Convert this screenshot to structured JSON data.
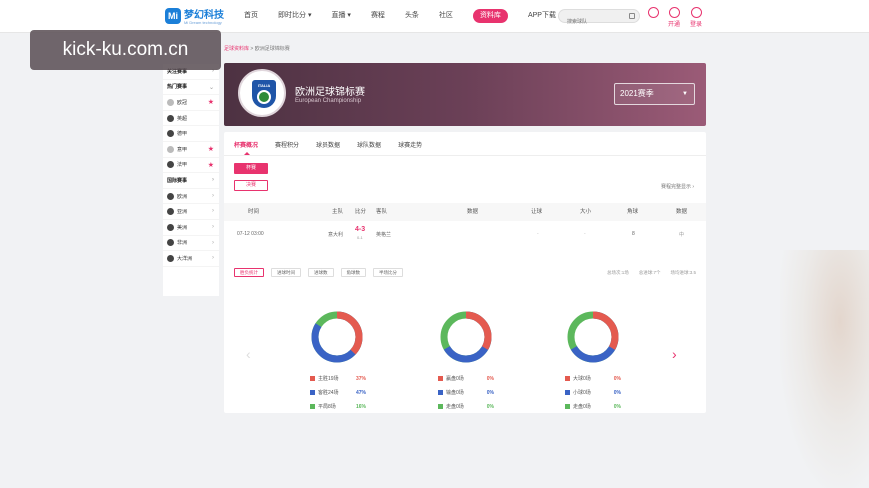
{
  "watermark": "kick-ku.com.cn",
  "header": {
    "logo_badge": "Mi",
    "logo_name": "梦幻科技",
    "logo_sub": "Mi Dream technology",
    "nav": [
      "首页",
      "即时比分 ▾",
      "直播 ▾",
      "赛程",
      "头条",
      "社区",
      "资料库",
      "APP下载"
    ],
    "search_placeholder": "搜索球队",
    "open_vip": "开通",
    "login": "登录"
  },
  "breadcrumb": {
    "link": "足球资料库",
    "sep": " > ",
    "current": "欧洲足球锦标赛"
  },
  "sidebar": {
    "items": [
      {
        "label": "关注赛事",
        "type": "head",
        "icon": "chevron-right"
      },
      {
        "label": "热门赛事",
        "type": "head",
        "icon": "chevron-down"
      },
      {
        "label": "欧冠",
        "type": "item",
        "icon": "star"
      },
      {
        "label": "英超",
        "type": "item"
      },
      {
        "label": "德甲",
        "type": "item"
      },
      {
        "label": "意甲",
        "type": "item",
        "icon": "star"
      },
      {
        "label": "法甲",
        "type": "item",
        "icon": "star"
      },
      {
        "label": "国际赛事",
        "type": "head",
        "icon": "chevron-right"
      },
      {
        "label": "欧洲",
        "type": "item",
        "icon": "chevron-right"
      },
      {
        "label": "亚洲",
        "type": "item",
        "icon": "chevron-right"
      },
      {
        "label": "美洲",
        "type": "item",
        "icon": "chevron-right"
      },
      {
        "label": "非洲",
        "type": "item",
        "icon": "chevron-right"
      },
      {
        "label": "大洋洲",
        "type": "item",
        "icon": "chevron-right"
      }
    ]
  },
  "banner": {
    "crest_text": "ITALIA",
    "title": "欧洲足球锦标赛",
    "subtitle": "European Championship",
    "season": "2021赛季"
  },
  "tabs": [
    "杯赛概况",
    "赛程积分",
    "球员数据",
    "球队数据",
    "球赛走势"
  ],
  "stages": [
    "杯赛",
    "决赛"
  ],
  "right_note": "赛程完整显示 ›",
  "table": {
    "headers": [
      "时间",
      "主队",
      "比分",
      "客队",
      "数据",
      "让球",
      "大小",
      "角球",
      "数据"
    ],
    "row": {
      "time": "07-12 03:00",
      "home": "意大利",
      "score": "4-3",
      "half": "0-1",
      "away": "英格兰",
      "handicap": "-",
      "total": "-",
      "corners": "8",
      "data": "中"
    }
  },
  "sub_tabs": [
    "胜负统计",
    "进球时间",
    "进球数",
    "角球数",
    "半场比分"
  ],
  "right_stats": [
    "总场次:1场",
    "总进球:7个",
    "场均进球:3.5"
  ],
  "colors": {
    "red": "#e45a4f",
    "blue": "#3a63c5",
    "green": "#5cb85c",
    "pink": "#e8336e"
  },
  "donuts": [
    {
      "legend": [
        {
          "label": "主胜19场",
          "pct": "37%",
          "color": "red"
        },
        {
          "label": "客胜24场",
          "pct": "47%",
          "color": "blue"
        },
        {
          "label": "平局8场",
          "pct": "16%",
          "color": "green"
        }
      ]
    },
    {
      "legend": [
        {
          "label": "赢盘0场",
          "pct": "0%",
          "color": "red"
        },
        {
          "label": "输盘0场",
          "pct": "0%",
          "color": "blue"
        },
        {
          "label": "走盘0场",
          "pct": "0%",
          "color": "green"
        }
      ]
    },
    {
      "legend": [
        {
          "label": "大球0场",
          "pct": "0%",
          "color": "red"
        },
        {
          "label": "小球0场",
          "pct": "0%",
          "color": "blue"
        },
        {
          "label": "走盘0场",
          "pct": "0%",
          "color": "green"
        }
      ]
    }
  ]
}
